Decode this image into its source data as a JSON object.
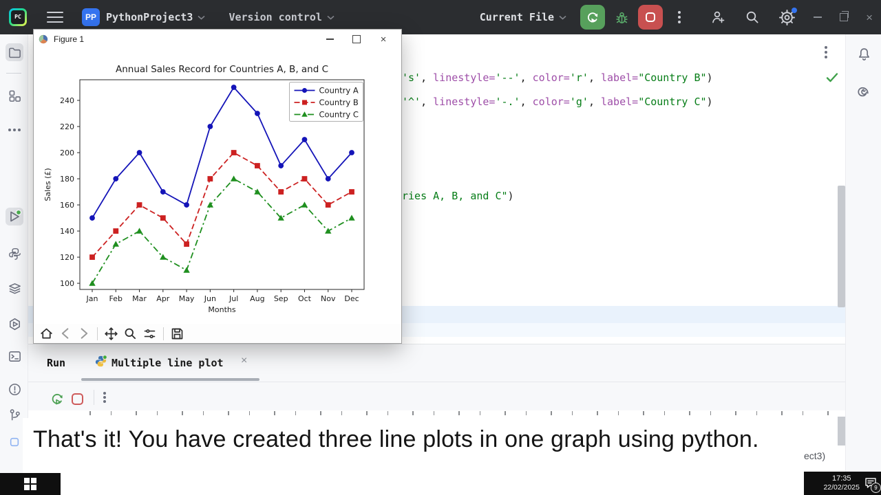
{
  "header": {
    "project_badge": "PP",
    "project": "PythonProject3",
    "vcs_menu": "Version control",
    "run_config": "Current File"
  },
  "colors": {
    "accent_blue": "#3574f0",
    "run_green": "#57a05c",
    "stop_red": "#c85050",
    "series_a_blue": "#1414b8",
    "series_b_red": "#cc2121",
    "series_c_green": "#1f8f1f"
  },
  "icons": {
    "pycharm-logo": "PC gradient square",
    "menu-icon": "hamburger",
    "rerun-icon": "circular arrow + play",
    "debug-icon": "bug",
    "stop-icon": "square",
    "add-user-icon": "person plus",
    "search-icon": "magnifier",
    "settings-icon": "gear + blue dot",
    "notifications-icon": "bell",
    "ai-assistant-icon": "spiral",
    "figure-app-icon": "matplotlib pie",
    "toolbar": [
      "home",
      "back",
      "forward",
      "pan",
      "zoom",
      "configure",
      "save"
    ]
  },
  "glyphs": {
    "close_x": "×"
  },
  "figure_window": {
    "title": "Figure 1"
  },
  "chart_data": {
    "type": "line",
    "title": "Annual Sales Record for Countries A, B, and C",
    "xlabel": "Months",
    "ylabel": "Sales (£)",
    "categories": [
      "Jan",
      "Feb",
      "Mar",
      "Apr",
      "May",
      "Jun",
      "Jul",
      "Aug",
      "Sep",
      "Oct",
      "Nov",
      "Dec"
    ],
    "yticks": [
      100,
      120,
      140,
      160,
      180,
      200,
      220,
      240
    ],
    "ylim": [
      95.3,
      255.8
    ],
    "grid": false,
    "legend_position": "top-right",
    "series": [
      {
        "name": "Country A",
        "color": "#1414b8",
        "marker": "circle",
        "linestyle": "solid",
        "values": [
          150,
          180,
          200,
          170,
          160,
          220,
          250,
          230,
          190,
          210,
          180,
          200
        ]
      },
      {
        "name": "Country B",
        "color": "#cc2121",
        "marker": "square",
        "linestyle": "dashed",
        "values": [
          120,
          140,
          160,
          150,
          130,
          180,
          200,
          190,
          170,
          180,
          160,
          170
        ]
      },
      {
        "name": "Country C",
        "color": "#1f8f1f",
        "marker": "triangle",
        "linestyle": "dashdot",
        "values": [
          100,
          130,
          140,
          120,
          110,
          160,
          180,
          170,
          150,
          160,
          140,
          150
        ]
      }
    ]
  },
  "editor": {
    "code_lines": [
      {
        "tokens": [
          {
            "t": "'s'",
            "c": "str"
          },
          {
            "t": ", ",
            "c": "pl"
          },
          {
            "t": "linestyle=",
            "c": "kw"
          },
          {
            "t": "'--'",
            "c": "str"
          },
          {
            "t": ", ",
            "c": "pl"
          },
          {
            "t": "color=",
            "c": "kw"
          },
          {
            "t": "'r'",
            "c": "str"
          },
          {
            "t": ", ",
            "c": "pl"
          },
          {
            "t": "label=",
            "c": "kw"
          },
          {
            "t": "\"Country B\"",
            "c": "str"
          },
          {
            "t": ")",
            "c": "pl"
          }
        ]
      },
      {
        "tokens": [
          {
            "t": "'^'",
            "c": "str"
          },
          {
            "t": ", ",
            "c": "pl"
          },
          {
            "t": "linestyle=",
            "c": "kw"
          },
          {
            "t": "'-.'",
            "c": "str"
          },
          {
            "t": ", ",
            "c": "pl"
          },
          {
            "t": "color=",
            "c": "kw"
          },
          {
            "t": "'g'",
            "c": "str"
          },
          {
            "t": ", ",
            "c": "pl"
          },
          {
            "t": "label=",
            "c": "kw"
          },
          {
            "t": "\"Country C\"",
            "c": "str"
          },
          {
            "t": ")",
            "c": "pl"
          }
        ]
      },
      {
        "tokens": [
          {
            "t": "ries A, B, and C\"",
            "c": "str"
          },
          {
            "t": ")",
            "c": "pl"
          }
        ]
      }
    ]
  },
  "run_panel": {
    "panel_label": "Run",
    "tab_label": "Multiple line plot"
  },
  "status_bar": {
    "fragment": "ect3)"
  },
  "caption": {
    "text": "That's it! You have created three line plots in one graph using python."
  },
  "taskbar": {
    "time": "17:35",
    "date": "22/02/2025",
    "notification_count": "9"
  }
}
